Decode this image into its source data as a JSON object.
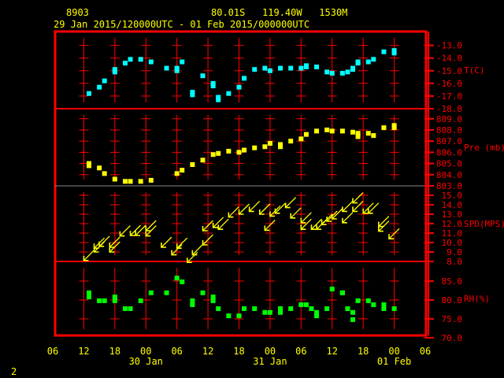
{
  "header": {
    "station": "8903",
    "location": "80.01S   119.40W   1530M",
    "period": "29 Jan 2015/120000UTC - 01 Feb 2015/000000UTC"
  },
  "footer": {
    "page": "2"
  },
  "colors": {
    "frame": "#ff0000",
    "text": "#ffff00",
    "temperature": "#00ffff",
    "pressure": "#ffff00",
    "wind": "#ffff00",
    "humidity": "#00ff00"
  },
  "chart_data": {
    "type": "scatter",
    "title": "",
    "x_range": [
      "2015-01-29 06:00",
      "2015-02-01 06:00"
    ],
    "x_tick_labels": [
      "06",
      "12",
      "18",
      "00",
      "06",
      "12",
      "18",
      "00",
      "06",
      "12",
      "18",
      "00",
      "06"
    ],
    "x_date_labels": [
      {
        "label": "30 Jan",
        "at": "2015-01-30 00:00"
      },
      {
        "label": "31 Jan",
        "at": "2015-01-31 00:00"
      },
      {
        "label": "01 Feb",
        "at": "2015-02-01 00:00"
      }
    ],
    "panels": [
      {
        "name": "T(C)",
        "kind": "points",
        "color": "#00ffff",
        "ylim": [
          -18,
          -11.9
        ],
        "ticks": [
          -13,
          -14,
          -15,
          -16,
          -17,
          -18
        ],
        "points": [
          [
            "2015-01-29 13:00",
            -16.8
          ],
          [
            "2015-01-29 15:00",
            -16.3
          ],
          [
            "2015-01-29 16:00",
            -15.8
          ],
          [
            "2015-01-29 18:00",
            -15.1
          ],
          [
            "2015-01-29 18:00",
            -14.9
          ],
          [
            "2015-01-29 20:00",
            -14.4
          ],
          [
            "2015-01-29 21:00",
            -14.1
          ],
          [
            "2015-01-29 23:00",
            -14.1
          ],
          [
            "2015-01-30 01:00",
            -14.3
          ],
          [
            "2015-01-30 04:00",
            -14.8
          ],
          [
            "2015-01-30 06:00",
            -14.8
          ],
          [
            "2015-01-30 06:00",
            -15.0
          ],
          [
            "2015-01-30 07:00",
            -14.3
          ],
          [
            "2015-01-30 09:00",
            -16.7
          ],
          [
            "2015-01-30 09:00",
            -16.9
          ],
          [
            "2015-01-30 11:00",
            -15.4
          ],
          [
            "2015-01-30 13:00",
            -16.0
          ],
          [
            "2015-01-30 13:00",
            -16.2
          ],
          [
            "2015-01-30 14:00",
            -17.1
          ],
          [
            "2015-01-30 14:00",
            -17.3
          ],
          [
            "2015-01-30 16:00",
            -16.8
          ],
          [
            "2015-01-30 18:00",
            -16.3
          ],
          [
            "2015-01-30 19:00",
            -15.6
          ],
          [
            "2015-01-30 21:00",
            -14.9
          ],
          [
            "2015-01-30 23:00",
            -14.8
          ],
          [
            "2015-01-31 00:00",
            -15.0
          ],
          [
            "2015-01-31 02:00",
            -14.8
          ],
          [
            "2015-01-31 04:00",
            -14.8
          ],
          [
            "2015-01-31 06:00",
            -14.8
          ],
          [
            "2015-01-31 07:00",
            -14.6
          ],
          [
            "2015-01-31 07:00",
            -14.7
          ],
          [
            "2015-01-31 09:00",
            -14.7
          ],
          [
            "2015-01-31 11:00",
            -15.1
          ],
          [
            "2015-01-31 12:00",
            -15.2
          ],
          [
            "2015-01-31 14:00",
            -15.2
          ],
          [
            "2015-01-31 15:00",
            -15.1
          ],
          [
            "2015-01-31 16:00",
            -14.8
          ],
          [
            "2015-01-31 16:00",
            -14.9
          ],
          [
            "2015-01-31 17:00",
            -14.4
          ],
          [
            "2015-01-31 17:00",
            -14.3
          ],
          [
            "2015-01-31 19:00",
            -14.3
          ],
          [
            "2015-01-31 20:00",
            -14.1
          ],
          [
            "2015-01-31 22:00",
            -13.5
          ],
          [
            "2015-02-01 00:00",
            -13.4
          ],
          [
            "2015-02-01 00:00",
            -13.6
          ]
        ]
      },
      {
        "name": "Pre (mb)",
        "kind": "points",
        "color": "#ffff00",
        "ylim": [
          803,
          809.9
        ],
        "ticks": [
          809,
          808,
          807,
          806,
          805,
          804,
          803
        ],
        "points": [
          [
            "2015-01-29 13:00",
            805.0
          ],
          [
            "2015-01-29 13:00",
            804.8
          ],
          [
            "2015-01-29 15:00",
            804.6
          ],
          [
            "2015-01-29 16:00",
            804.1
          ],
          [
            "2015-01-29 18:00",
            803.6
          ],
          [
            "2015-01-29 20:00",
            803.4
          ],
          [
            "2015-01-29 21:00",
            803.4
          ],
          [
            "2015-01-29 23:00",
            803.4
          ],
          [
            "2015-01-30 01:00",
            803.5
          ],
          [
            "2015-01-30 06:00",
            804.1
          ],
          [
            "2015-01-30 07:00",
            804.4
          ],
          [
            "2015-01-30 09:00",
            804.9
          ],
          [
            "2015-01-30 11:00",
            805.3
          ],
          [
            "2015-01-30 13:00",
            805.8
          ],
          [
            "2015-01-30 14:00",
            805.9
          ],
          [
            "2015-01-30 16:00",
            806.1
          ],
          [
            "2015-01-30 18:00",
            806.0
          ],
          [
            "2015-01-30 19:00",
            806.2
          ],
          [
            "2015-01-30 21:00",
            806.4
          ],
          [
            "2015-01-30 23:00",
            806.5
          ],
          [
            "2015-01-31 00:00",
            806.8
          ],
          [
            "2015-01-31 02:00",
            806.7
          ],
          [
            "2015-01-31 02:00",
            806.5
          ],
          [
            "2015-01-31 04:00",
            807.0
          ],
          [
            "2015-01-31 06:00",
            807.2
          ],
          [
            "2015-01-31 07:00",
            807.6
          ],
          [
            "2015-01-31 09:00",
            807.9
          ],
          [
            "2015-01-31 11:00",
            808.0
          ],
          [
            "2015-01-31 12:00",
            807.9
          ],
          [
            "2015-01-31 14:00",
            807.9
          ],
          [
            "2015-01-31 16:00",
            807.8
          ],
          [
            "2015-01-31 17:00",
            807.4
          ],
          [
            "2015-01-31 17:00",
            807.7
          ],
          [
            "2015-01-31 19:00",
            807.7
          ],
          [
            "2015-01-31 20:00",
            807.5
          ],
          [
            "2015-01-31 22:00",
            808.2
          ],
          [
            "2015-02-01 00:00",
            808.2
          ],
          [
            "2015-02-01 00:00",
            808.4
          ]
        ]
      },
      {
        "name": "SPD(MPS)",
        "kind": "wind-vectors",
        "color": "#ffff00",
        "direction": "from NE",
        "ylim": [
          8,
          16
        ],
        "ticks": [
          15,
          14,
          13,
          12,
          11,
          10,
          9,
          8
        ],
        "points": [
          [
            "2015-01-29 12:00",
            8.1
          ],
          [
            "2015-01-29 14:00",
            9.0
          ],
          [
            "2015-01-29 14:00",
            9.4
          ],
          [
            "2015-01-29 15:00",
            9.6
          ],
          [
            "2015-01-29 17:00",
            9.0
          ],
          [
            "2015-01-29 17:00",
            9.5
          ],
          [
            "2015-01-29 19:00",
            10.7
          ],
          [
            "2015-01-29 21:00",
            10.75
          ],
          [
            "2015-01-29 22:00",
            10.75
          ],
          [
            "2015-01-30 00:00",
            10.7
          ],
          [
            "2015-01-30 00:00",
            11.25
          ],
          [
            "2015-01-30 03:00",
            9.5
          ],
          [
            "2015-01-30 05:00",
            8.7
          ],
          [
            "2015-01-30 06:00",
            9.4
          ],
          [
            "2015-01-30 08:00",
            7.9
          ],
          [
            "2015-01-30 09:00",
            8.7
          ],
          [
            "2015-01-30 11:00",
            9.75
          ],
          [
            "2015-01-30 11:00",
            11.25
          ],
          [
            "2015-01-30 13:00",
            11.6
          ],
          [
            "2015-01-30 14:00",
            11.4
          ],
          [
            "2015-01-30 16:00",
            12.7
          ],
          [
            "2015-01-30 18:00",
            13.0
          ],
          [
            "2015-01-30 20:00",
            13.3
          ],
          [
            "2015-01-30 22:00",
            13.0
          ],
          [
            "2015-01-30 23:00",
            11.3
          ],
          [
            "2015-01-31 00:00",
            12.8
          ],
          [
            "2015-01-31 01:00",
            13.1
          ],
          [
            "2015-01-31 03:00",
            13.7
          ],
          [
            "2015-01-31 04:00",
            12.6
          ],
          [
            "2015-01-31 06:00",
            12.1
          ],
          [
            "2015-01-31 06:00",
            11.4
          ],
          [
            "2015-01-31 08:00",
            11.4
          ],
          [
            "2015-01-31 09:00",
            11.4
          ],
          [
            "2015-01-31 10:00",
            11.9
          ],
          [
            "2015-01-31 11:00",
            12.25
          ],
          [
            "2015-01-31 12:00",
            12.5
          ],
          [
            "2015-01-31 14:00",
            12.1
          ],
          [
            "2015-01-31 14:00",
            13.3
          ],
          [
            "2015-01-31 16:00",
            14.2
          ],
          [
            "2015-01-31 16:00",
            13.3
          ],
          [
            "2015-01-31 18:00",
            13.1
          ],
          [
            "2015-01-31 19:00",
            13.1
          ],
          [
            "2015-01-31 21:00",
            11.7
          ],
          [
            "2015-01-31 21:00",
            11.2
          ],
          [
            "2015-01-31 23:00",
            10.4
          ]
        ]
      },
      {
        "name": "RH(%)",
        "kind": "points",
        "color": "#00ff00",
        "ylim": [
          70.6,
          90.2
        ],
        "ticks": [
          85,
          80,
          75,
          70
        ],
        "points": [
          [
            "2015-01-29 13:00",
            81.9
          ],
          [
            "2015-01-29 13:00",
            80.8
          ],
          [
            "2015-01-29 15:00",
            79.8
          ],
          [
            "2015-01-29 16:00",
            79.8
          ],
          [
            "2015-01-29 18:00",
            80.8
          ],
          [
            "2015-01-29 18:00",
            79.8
          ],
          [
            "2015-01-29 20:00",
            77.7
          ],
          [
            "2015-01-29 21:00",
            77.7
          ],
          [
            "2015-01-29 23:00",
            79.8
          ],
          [
            "2015-01-30 01:00",
            81.9
          ],
          [
            "2015-01-30 04:00",
            81.9
          ],
          [
            "2015-01-30 06:00",
            85.8
          ],
          [
            "2015-01-30 07:00",
            84.8
          ],
          [
            "2015-01-30 09:00",
            78.75
          ],
          [
            "2015-01-30 09:00",
            79.8
          ],
          [
            "2015-01-30 11:00",
            81.9
          ],
          [
            "2015-01-30 13:00",
            80.8
          ],
          [
            "2015-01-30 13:00",
            79.8
          ],
          [
            "2015-01-30 14:00",
            77.7
          ],
          [
            "2015-01-30 16:00",
            75.8
          ],
          [
            "2015-01-30 18:00",
            75.8
          ],
          [
            "2015-01-30 19:00",
            77.7
          ],
          [
            "2015-01-30 21:00",
            77.7
          ],
          [
            "2015-01-30 23:00",
            76.7
          ],
          [
            "2015-01-31 00:00",
            76.7
          ],
          [
            "2015-01-31 02:00",
            76.7
          ],
          [
            "2015-01-31 02:00",
            77.7
          ],
          [
            "2015-01-31 04:00",
            77.7
          ],
          [
            "2015-01-31 06:00",
            78.75
          ],
          [
            "2015-01-31 07:00",
            78.75
          ],
          [
            "2015-01-31 08:00",
            77.7
          ],
          [
            "2015-01-31 09:00",
            76.7
          ],
          [
            "2015-01-31 09:00",
            75.8
          ],
          [
            "2015-01-31 11:00",
            77.7
          ],
          [
            "2015-01-31 12:00",
            82.9
          ],
          [
            "2015-01-31 14:00",
            81.9
          ],
          [
            "2015-01-31 14:00",
            81.9
          ],
          [
            "2015-01-31 15:00",
            77.7
          ],
          [
            "2015-01-31 16:00",
            76.7
          ],
          [
            "2015-01-31 16:00",
            74.8
          ],
          [
            "2015-01-31 17:00",
            79.8
          ],
          [
            "2015-01-31 19:00",
            79.8
          ],
          [
            "2015-01-31 20:00",
            78.75
          ],
          [
            "2015-01-31 22:00",
            78.75
          ],
          [
            "2015-01-31 22:00",
            77.7
          ],
          [
            "2015-02-01 00:00",
            77.7
          ]
        ]
      }
    ]
  }
}
